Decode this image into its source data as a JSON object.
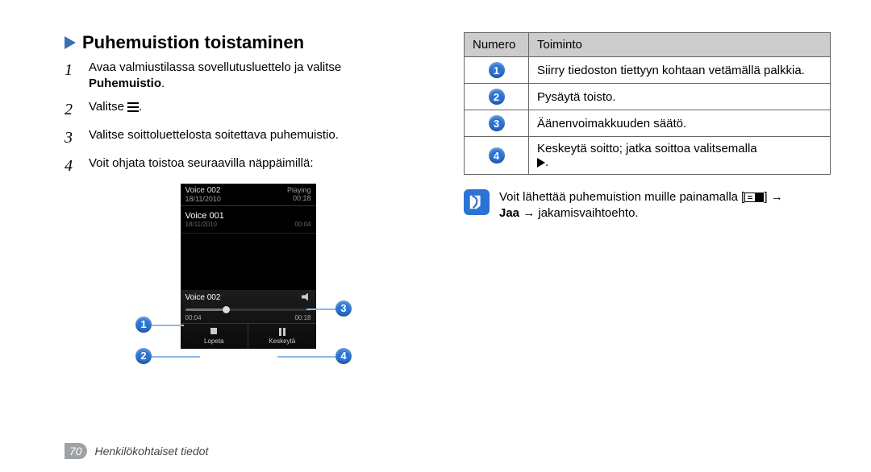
{
  "heading": "Puhemuistion toistaminen",
  "steps": {
    "s1a": "Avaa valmiustilassa sovellutusluettelo ja valitse",
    "s1b": "Puhemuistio",
    "s1c": ".",
    "s2a": "Valitse",
    "s2b": ".",
    "s3": "Valitse soittoluettelosta soitettava puhemuistio.",
    "s4": "Voit ohjata toistoa seuraavilla näppäimillä:"
  },
  "phone": {
    "np_title": "Voice 002",
    "np_status": "Playing",
    "np_date": "18/11/2010",
    "np_dur_top": "00:18",
    "item_title": "Voice 001",
    "item_date": "18/11/2010",
    "item_dur": "00:04",
    "player_title": "Voice 002",
    "t_elapsed": "00:04",
    "t_total": "00:18",
    "btn_stop": "Lopeta",
    "btn_pause": "Keskeytä"
  },
  "table": {
    "h1": "Numero",
    "h2": "Toiminto",
    "r1": "Siirry tiedoston tiettyyn kohtaan vetämällä palkkia.",
    "r2": "Pysäytä toisto.",
    "r3": "Äänenvoimakkuuden säätö.",
    "r4a": "Keskeytä soitto; jatka soittoa valitsemalla",
    "r4b": "."
  },
  "note": {
    "part1": "Voit lähettää puhemuistion muille painamalla [",
    "part2": "] →",
    "part3a": "Jaa",
    "part3b": " → jakamisvaihtoehto."
  },
  "footer": {
    "page": "70",
    "section": "Henkilökohtaiset tiedot"
  }
}
